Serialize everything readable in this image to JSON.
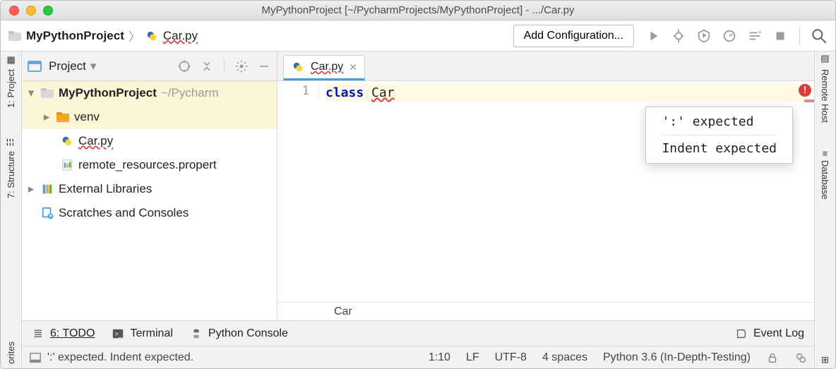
{
  "window": {
    "title": "MyPythonProject [~/PycharmProjects/MyPythonProject] - .../Car.py"
  },
  "breadcrumb": {
    "project": "MyPythonProject",
    "file": "Car.py"
  },
  "toolbar": {
    "add_config": "Add Configuration..."
  },
  "left_rail": {
    "project": "1: Project",
    "structure": "7: Structure",
    "favorites": "orites"
  },
  "right_rail": {
    "remote": "Remote Host",
    "database": "Database"
  },
  "project_panel": {
    "title": "Project"
  },
  "tabs": {
    "active": "Car.py"
  },
  "tree": {
    "root": {
      "name": "MyPythonProject",
      "path": "~/Pycharm"
    },
    "items": [
      {
        "name": "venv",
        "kind": "folder"
      },
      {
        "name": "Car.py",
        "kind": "pyfile"
      },
      {
        "name": "remote_resources.propert",
        "kind": "propfile"
      }
    ],
    "external": "External Libraries",
    "scratches": "Scratches and Consoles"
  },
  "editor": {
    "line_no": "1",
    "kw": "class",
    "ident": "Car",
    "crumb": "Car",
    "tooltip": {
      "l1": "':' expected",
      "l2": "Indent expected"
    }
  },
  "bottom": {
    "todo": "6: TODO",
    "terminal": "Terminal",
    "pyconsole": "Python Console",
    "eventlog": "Event Log"
  },
  "status": {
    "msg": "':' expected. Indent expected.",
    "pos": "1:10",
    "sep": "LF",
    "enc": "UTF-8",
    "indent": "4 spaces",
    "interp": "Python 3.6 (In-Depth-Testing)"
  }
}
